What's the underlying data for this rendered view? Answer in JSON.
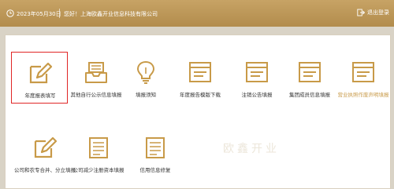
{
  "header": {
    "date": "2023年05月30日",
    "greeting": "您好！",
    "company": "上海欧鑫开业信息科技有限公司",
    "logout_label": "退出登录"
  },
  "watermark": "欧鑫开业",
  "tiles": [
    {
      "label": "年度报表填写",
      "icon": "pencil-edit-icon"
    },
    {
      "label": "其他自行公示信息填报",
      "icon": "inbox-tray-icon"
    },
    {
      "label": "填报须知",
      "icon": "lightbulb-icon"
    },
    {
      "label": "年度报告模版下载",
      "icon": "browser-window-icon"
    },
    {
      "label": "注销公告填报",
      "icon": "browser-window-icon"
    },
    {
      "label": "集团成员信息填报",
      "icon": "browser-window-icon"
    },
    {
      "label": "营业执照作废声明填报",
      "icon": "browser-window-icon"
    },
    {
      "label": "公司和农专合并、分立填报",
      "icon": "pencil-edit-icon"
    },
    {
      "label": "公司减少注册资本填报",
      "icon": "document-lines-icon"
    },
    {
      "label": "信用信息修复",
      "icon": "document-lines-icon"
    }
  ]
}
